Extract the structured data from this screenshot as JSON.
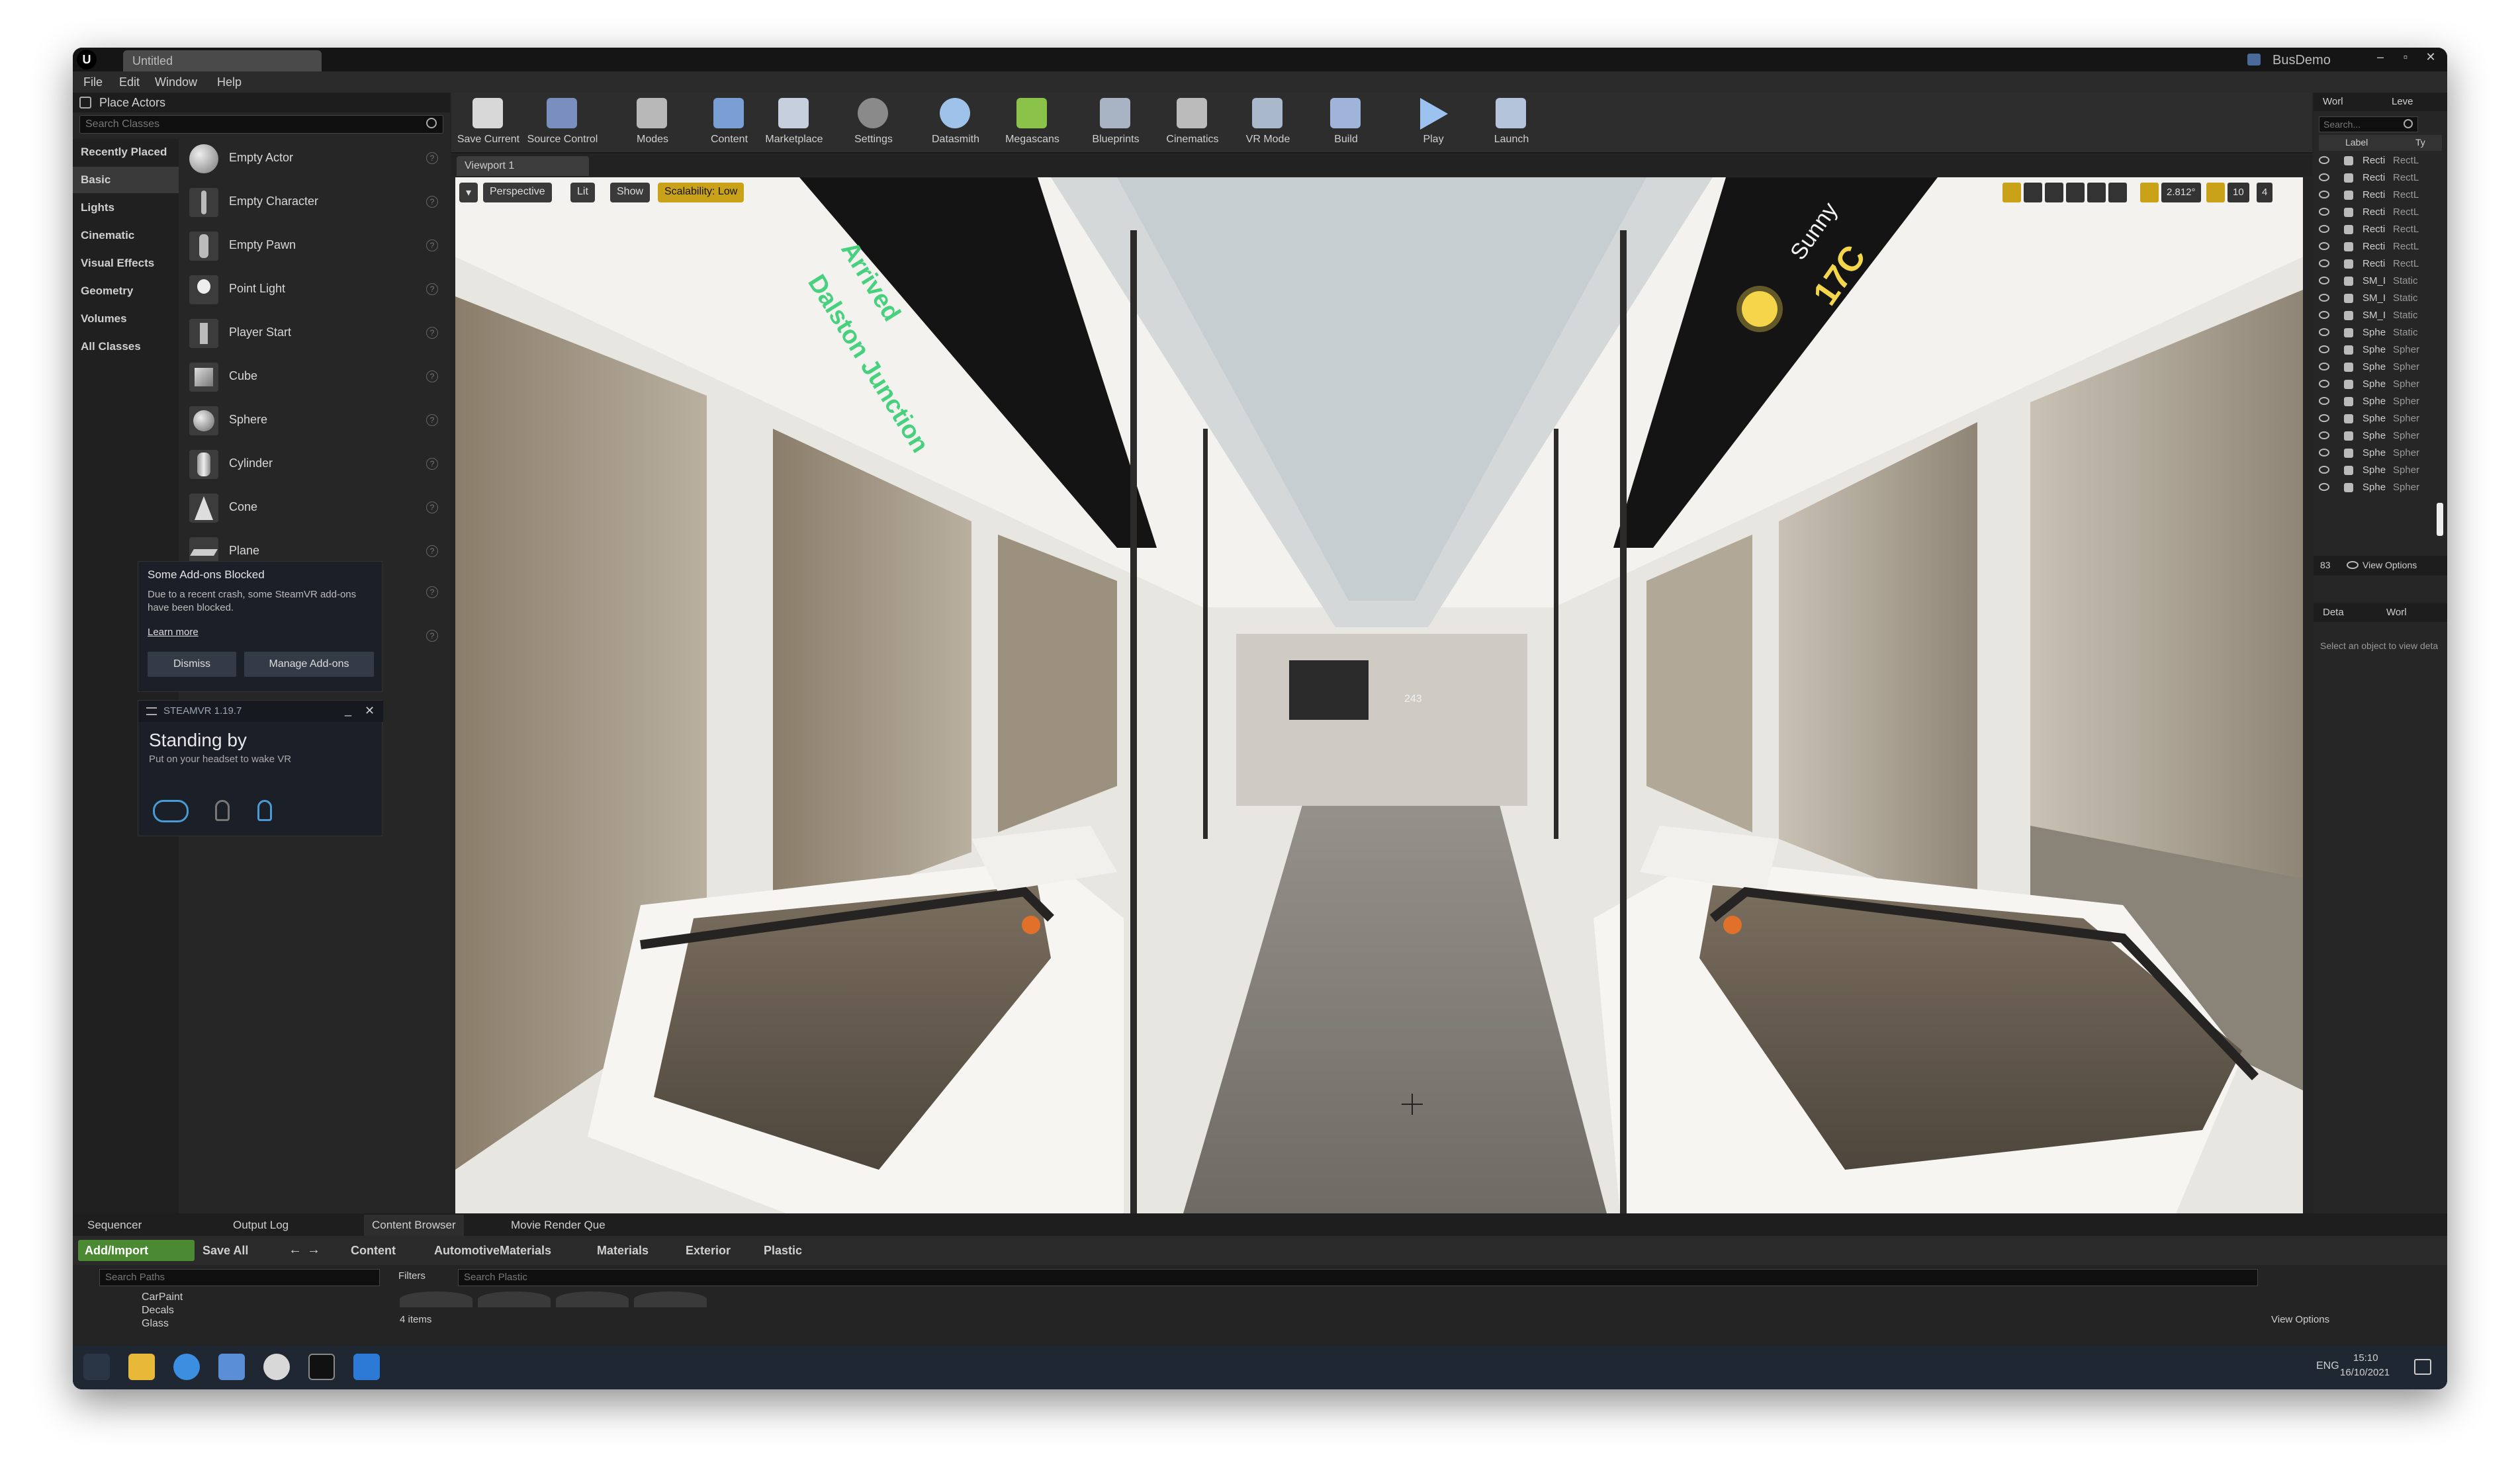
{
  "window": {
    "doc_tab": "Untitled",
    "project_name": "BusDemo"
  },
  "menu": [
    "File",
    "Edit",
    "Window",
    "Help"
  ],
  "place_actors": {
    "tab_label": "Place Actors",
    "search_placeholder": "Search Classes",
    "categories": [
      "Recently Placed",
      "Basic",
      "Lights",
      "Cinematic",
      "Visual Effects",
      "Geometry",
      "Volumes",
      "All Classes"
    ],
    "actors": [
      "Empty Actor",
      "Empty Character",
      "Empty Pawn",
      "Point Light",
      "Player Start",
      "Cube",
      "Sphere",
      "Cylinder",
      "Cone",
      "Plane"
    ]
  },
  "notification": {
    "title": "Some Add-ons Blocked",
    "body": "Due to a recent crash, some SteamVR add-ons have been blocked.",
    "link": "Learn more",
    "dismiss": "Dismiss",
    "manage": "Manage Add-ons"
  },
  "steamvr": {
    "header": "STEAMVR 1.19.7",
    "status": "Standing by",
    "hint": "Put on your headset to wake VR"
  },
  "toolbar": {
    "buttons": [
      "Save Current",
      "Source Control",
      "Modes",
      "Content",
      "Marketplace",
      "Settings",
      "Datasmith",
      "Megascans",
      "Blueprints",
      "Cinematics",
      "VR Mode",
      "Build",
      "Play",
      "Launch"
    ]
  },
  "viewport": {
    "tab": "Viewport 1",
    "perspective": "Perspective",
    "lit": "Lit",
    "show": "Show",
    "scalability": "Scalability: Low",
    "angle": "2.812°",
    "grid": "10",
    "cam_speed": "4",
    "sign_arrived": "Arrived",
    "sign_station": "Dalston Junction",
    "sign_weather": "Sunny",
    "sign_temp": "17C",
    "bus_number": "243"
  },
  "outliner": {
    "tabs": [
      "Worl",
      "Leve"
    ],
    "search_placeholder": "Search...",
    "col_label": "Label",
    "col_type": "Ty",
    "rows": [
      {
        "name": "Recti",
        "type": "RectL"
      },
      {
        "name": "Recti",
        "type": "RectL"
      },
      {
        "name": "Recti",
        "type": "RectL"
      },
      {
        "name": "Recti",
        "type": "RectL"
      },
      {
        "name": "Recti",
        "type": "RectL"
      },
      {
        "name": "Recti",
        "type": "RectL"
      },
      {
        "name": "Recti",
        "type": "RectL"
      },
      {
        "name": "SM_I",
        "type": "Static"
      },
      {
        "name": "SM_I",
        "type": "Static"
      },
      {
        "name": "SM_I",
        "type": "Static"
      },
      {
        "name": "Sphe",
        "type": "Static"
      },
      {
        "name": "Sphe",
        "type": "Spher"
      },
      {
        "name": "Sphe",
        "type": "Spher"
      },
      {
        "name": "Sphe",
        "type": "Spher"
      },
      {
        "name": "Sphe",
        "type": "Spher"
      },
      {
        "name": "Sphe",
        "type": "Spher"
      },
      {
        "name": "Sphe",
        "type": "Spher"
      },
      {
        "name": "Sphe",
        "type": "Spher"
      },
      {
        "name": "Sphe",
        "type": "Spher"
      },
      {
        "name": "Sphe",
        "type": "Spher"
      }
    ],
    "count": "83",
    "view_options": "View Options"
  },
  "details": {
    "tabs": [
      "Deta",
      "Worl"
    ],
    "empty": "Select an object to view deta"
  },
  "bottom_tabs": [
    "Sequencer",
    "Output Log",
    "Content Browser",
    "Movie Render Que"
  ],
  "content_browser": {
    "add_import": "Add/Import",
    "save_all": "Save All",
    "breadcrumb": [
      "Content",
      "AutomotiveMaterials",
      "Materials",
      "Exterior",
      "Plastic"
    ],
    "search_paths": "Search Paths",
    "filters": "Filters",
    "search_assets": "Search Plastic",
    "folders": [
      "CarPaint",
      "Decals",
      "Glass"
    ],
    "item_count": "4 items",
    "view_options": "View Options"
  },
  "taskbar": {
    "lang": "ENG",
    "time": "15:10",
    "date": "16/10/2021"
  }
}
